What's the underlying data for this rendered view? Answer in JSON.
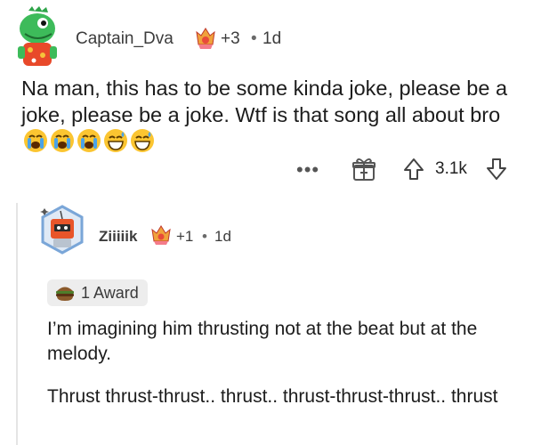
{
  "comment1": {
    "username": "Captain_Dva",
    "award_count": "+3",
    "separator": "•",
    "time": "1d",
    "text": "Na man, this has to be some kinda joke, please be a joke, please be a joke. Wtf is that song all about bro",
    "emojis": [
      "loudly-crying-face",
      "loudly-crying-face",
      "loudly-crying-face",
      "grinning-sweat-face",
      "grinning-sweat-face"
    ],
    "actions": {
      "more": "•••",
      "score": "3.1k"
    }
  },
  "comment2": {
    "username": "Ziiiiik",
    "award_count": "+1",
    "separator": "•",
    "time": "1d",
    "award_badge": "1 Award",
    "text_paragraph1": "I’m imagining him thrusting not at the beat but at the melody.",
    "text_paragraph2": "Thrust thrust-thrust.. thrust.. thrust-thrust-thrust.. thrust"
  },
  "colors": {
    "text": "#1c1c1c",
    "meta": "#3c3c3c",
    "award_pill_bg": "#ededed",
    "thread_line": "#e5e5e5"
  }
}
